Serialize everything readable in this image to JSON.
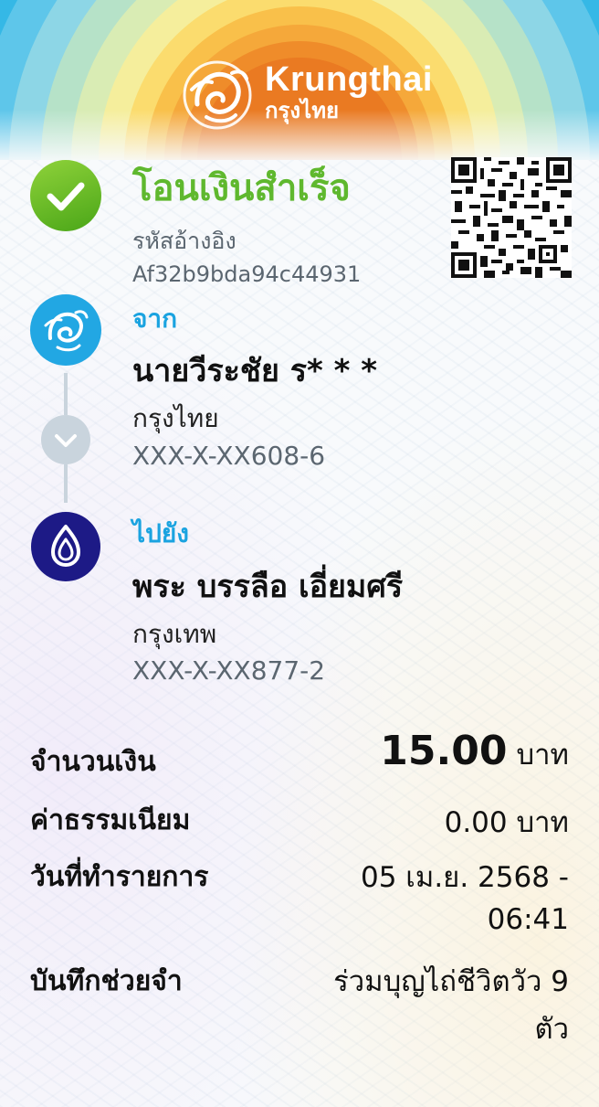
{
  "brand": {
    "name_en": "Krungthai",
    "name_th": "กรุงไทย"
  },
  "status": {
    "title": "โอนเงินสำเร็จ",
    "ref_label": "รหัสอ้างอิง",
    "ref_value": "Af32b9bda94c44931",
    "color": "#5fb82e"
  },
  "from": {
    "label": "จาก",
    "name": "นายวีระชัย ร* * *",
    "bank": "กรุงไทย",
    "account": "XXX-X-XX608-6",
    "icon": "krungthai-logo-icon"
  },
  "to": {
    "label": "ไปยัง",
    "name": "พระ บรรลือ เอี่ยมศรี",
    "bank": "กรุงเทพ",
    "account": "XXX-X-XX877-2",
    "icon": "bangkok-bank-logo-icon"
  },
  "details": {
    "amount_label": "จำนวนเงิน",
    "amount_value": "15.00",
    "amount_unit": "บาท",
    "fee_label": "ค่าธรรมเนียม",
    "fee_value": "0.00 บาท",
    "date_label": "วันที่ทำรายการ",
    "date_value_line1": "05 เม.ย. 2568 -",
    "date_value_line2": "06:41",
    "memo_label": "บันทึกช่วยจำ",
    "memo_value_line1": "ร่วมบุญไถ่ชีวิตวัว 9",
    "memo_value_line2": "ตัว"
  },
  "colors": {
    "accent_blue": "#1aa3e0",
    "success_green": "#5fb82e",
    "bbl_navy": "#1d1a86"
  }
}
